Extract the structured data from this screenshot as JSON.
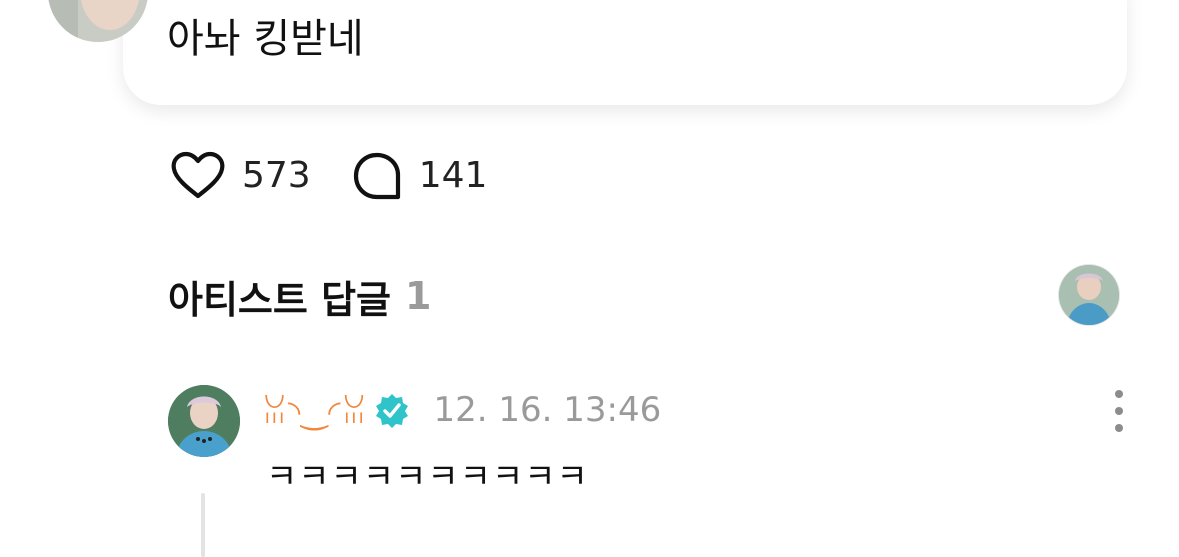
{
  "post": {
    "text": "아놔 킹받네",
    "avatar_icon": "user-avatar"
  },
  "stats": {
    "likes": "573",
    "comments": "141",
    "like_icon": "heart-icon",
    "comment_icon": "comment-bubble-icon"
  },
  "artist_replies": {
    "title": "아티스트 답글",
    "count": "1",
    "avatar_icon": "artist-avatar"
  },
  "reply": {
    "author": "ꈍ◝‿◜ꈍ",
    "verified_icon": "verified-badge-icon",
    "time": "12. 16. 13:46",
    "text": "ㅋㅋㅋㅋㅋㅋㅋㅋㅋㅋ",
    "more_icon": "more-vertical-icon"
  },
  "colors": {
    "author_name": "#f2863a",
    "verified_badge": "#2ec4c9",
    "muted_text": "#9a9a9a",
    "thread_line": "#e3e3e3"
  }
}
